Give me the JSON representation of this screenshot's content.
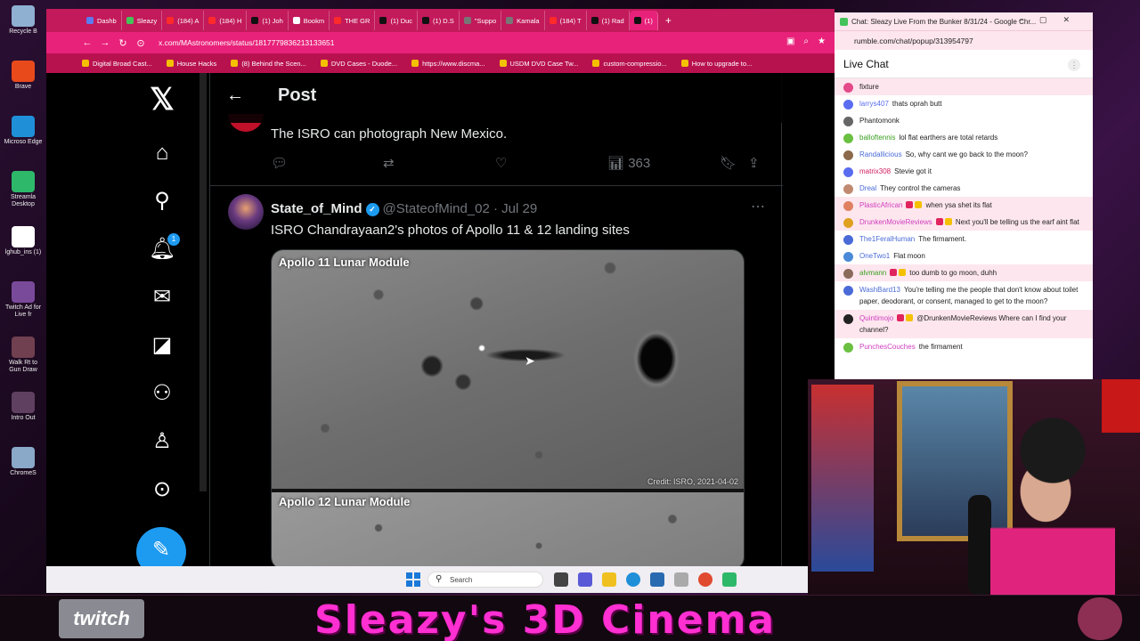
{
  "desktop": {
    "icons": [
      {
        "label": "Recycle B",
        "color": "#8fb0d0"
      },
      {
        "label": "Brave",
        "color": "#e84a1c"
      },
      {
        "label": "Microso Edge",
        "color": "#1f8fd8"
      },
      {
        "label": "Streamla Desktop",
        "color": "#2db86a"
      },
      {
        "label": "lghub_ins (1)",
        "color": "#ffffff"
      },
      {
        "label": "Twitch Ad for Live fr",
        "color": "#7a4a9a"
      },
      {
        "label": "Walk Rt to Gun Draw",
        "color": "#704050"
      },
      {
        "label": "Intro Out",
        "color": "#604060"
      },
      {
        "label": "ChromeS",
        "color": "#8aa8c8"
      }
    ]
  },
  "browser": {
    "tabs": [
      {
        "label": "Dashb",
        "color": "#5a7cf0"
      },
      {
        "label": "Sleazy",
        "color": "#44c35a"
      },
      {
        "label": "(184) A",
        "color": "#ff2a2a"
      },
      {
        "label": "(184) H",
        "color": "#ff2a2a"
      },
      {
        "label": "(1) Joh",
        "color": "#111111"
      },
      {
        "label": "Bookm",
        "color": "#ffffff"
      },
      {
        "label": "THE GR",
        "color": "#ff2a2a"
      },
      {
        "label": "(1) Duc",
        "color": "#111111"
      },
      {
        "label": "(1) D.S",
        "color": "#111111"
      },
      {
        "label": "\"Suppo",
        "color": "#777777"
      },
      {
        "label": "Kamala",
        "color": "#777777"
      },
      {
        "label": "(184) T",
        "color": "#ff2a2a"
      },
      {
        "label": "(1) Rad",
        "color": "#111111"
      },
      {
        "label": "(1)",
        "color": "#111111",
        "active": true
      }
    ],
    "url": "x.com/MAstronomers/status/1817779836213133651",
    "bookmarks": [
      "Digital Broad Cast...",
      "House Hacks",
      "(8) Behind the Scen...",
      "DVD Cases - Duode...",
      "https://www.discma...",
      "USDM DVD Case Tw...",
      "custom-compressio...",
      "How to upgrade to..."
    ]
  },
  "x": {
    "logo": "𝕏",
    "notif_count": "1",
    "header_title": "Post",
    "prev_text": "The ISRO can photograph New Mexico.",
    "prev_views": "363",
    "author_name": "State_of_Mind",
    "author_handle": "@StateofMind_02 · Jul 29",
    "tweet_text": "ISRO Chandrayaan2's photos of Apollo 11 & 12 landing sites",
    "media": {
      "label1": "Apollo 11 Lunar Module",
      "label2": "Apollo 12 Lunar Module",
      "credit": "Credit: ISRO, 2021-04-02"
    }
  },
  "chat": {
    "window_title": "Chat: Sleazy Live From the Bunker 8/31/24 - Google Chr...",
    "url": "rumble.com/chat/popup/313954797",
    "heading": "Live Chat",
    "messages": [
      {
        "user": "",
        "text": "fixture",
        "color": "#e44a8a",
        "hi": true
      },
      {
        "user": "larrys407",
        "text": "thats oprah butt",
        "color": "#5a6cf0",
        "ucolor": "#5a6cf0"
      },
      {
        "user": "Phantomonk",
        "text": "",
        "color": "#666",
        "ucolor": "#222"
      },
      {
        "user": "balloftennis",
        "text": "lol flat earthers are total retards",
        "color": "#6ac040",
        "ucolor": "#3aa020"
      },
      {
        "user": "Randallicious",
        "text": "So, why cant we go back to the moon?",
        "color": "#8a6a4a",
        "ucolor": "#4a6ad8"
      },
      {
        "user": "matrix308",
        "text": "Stevie got it",
        "color": "#5a6cf0",
        "ucolor": "#d02060"
      },
      {
        "user": "Dreal",
        "text": "They control the cameras",
        "color": "#c08a70",
        "ucolor": "#4a6ad8"
      },
      {
        "user": "PlasticAfrican",
        "text": "when ysa shet its flat",
        "color": "#e08060",
        "ucolor": "#d040c0",
        "hi": true
      },
      {
        "user": "DrunkenMovieReviews",
        "text": "Next you'll be telling us the earf aint flat",
        "color": "#e0a020",
        "ucolor": "#d040c0",
        "hi": true
      },
      {
        "user": "The1FeralHuman",
        "text": "The firmament.",
        "color": "#4a6ad8",
        "ucolor": "#4a6ad8"
      },
      {
        "user": "OneTwo1",
        "text": "Flat moon",
        "color": "#4a8ad8",
        "ucolor": "#4a6ad8"
      },
      {
        "user": "alvmann",
        "text": "too dumb to go moon, duhh",
        "color": "#8a6a5a",
        "ucolor": "#3aa020",
        "hi": true
      },
      {
        "user": "WashBard13",
        "text": "You're telling me the people that don't know about toilet paper, deodorant, or consent, managed to get to the moon?",
        "color": "#4a6ad8",
        "ucolor": "#4a6ad8"
      },
      {
        "user": "Quintimojo",
        "text": "@DrunkenMovieReviews Where can I find your channel?",
        "color": "#222",
        "ucolor": "#d040c0",
        "hi": true
      },
      {
        "user": "PunchesCouches",
        "text": "the firmament",
        "color": "#6ac040",
        "ucolor": "#d040c0"
      }
    ]
  },
  "taskbar": {
    "search_placeholder": "Search"
  },
  "banner": {
    "twitch": "twitch",
    "title": "Sleazy's 3D Cinema"
  }
}
